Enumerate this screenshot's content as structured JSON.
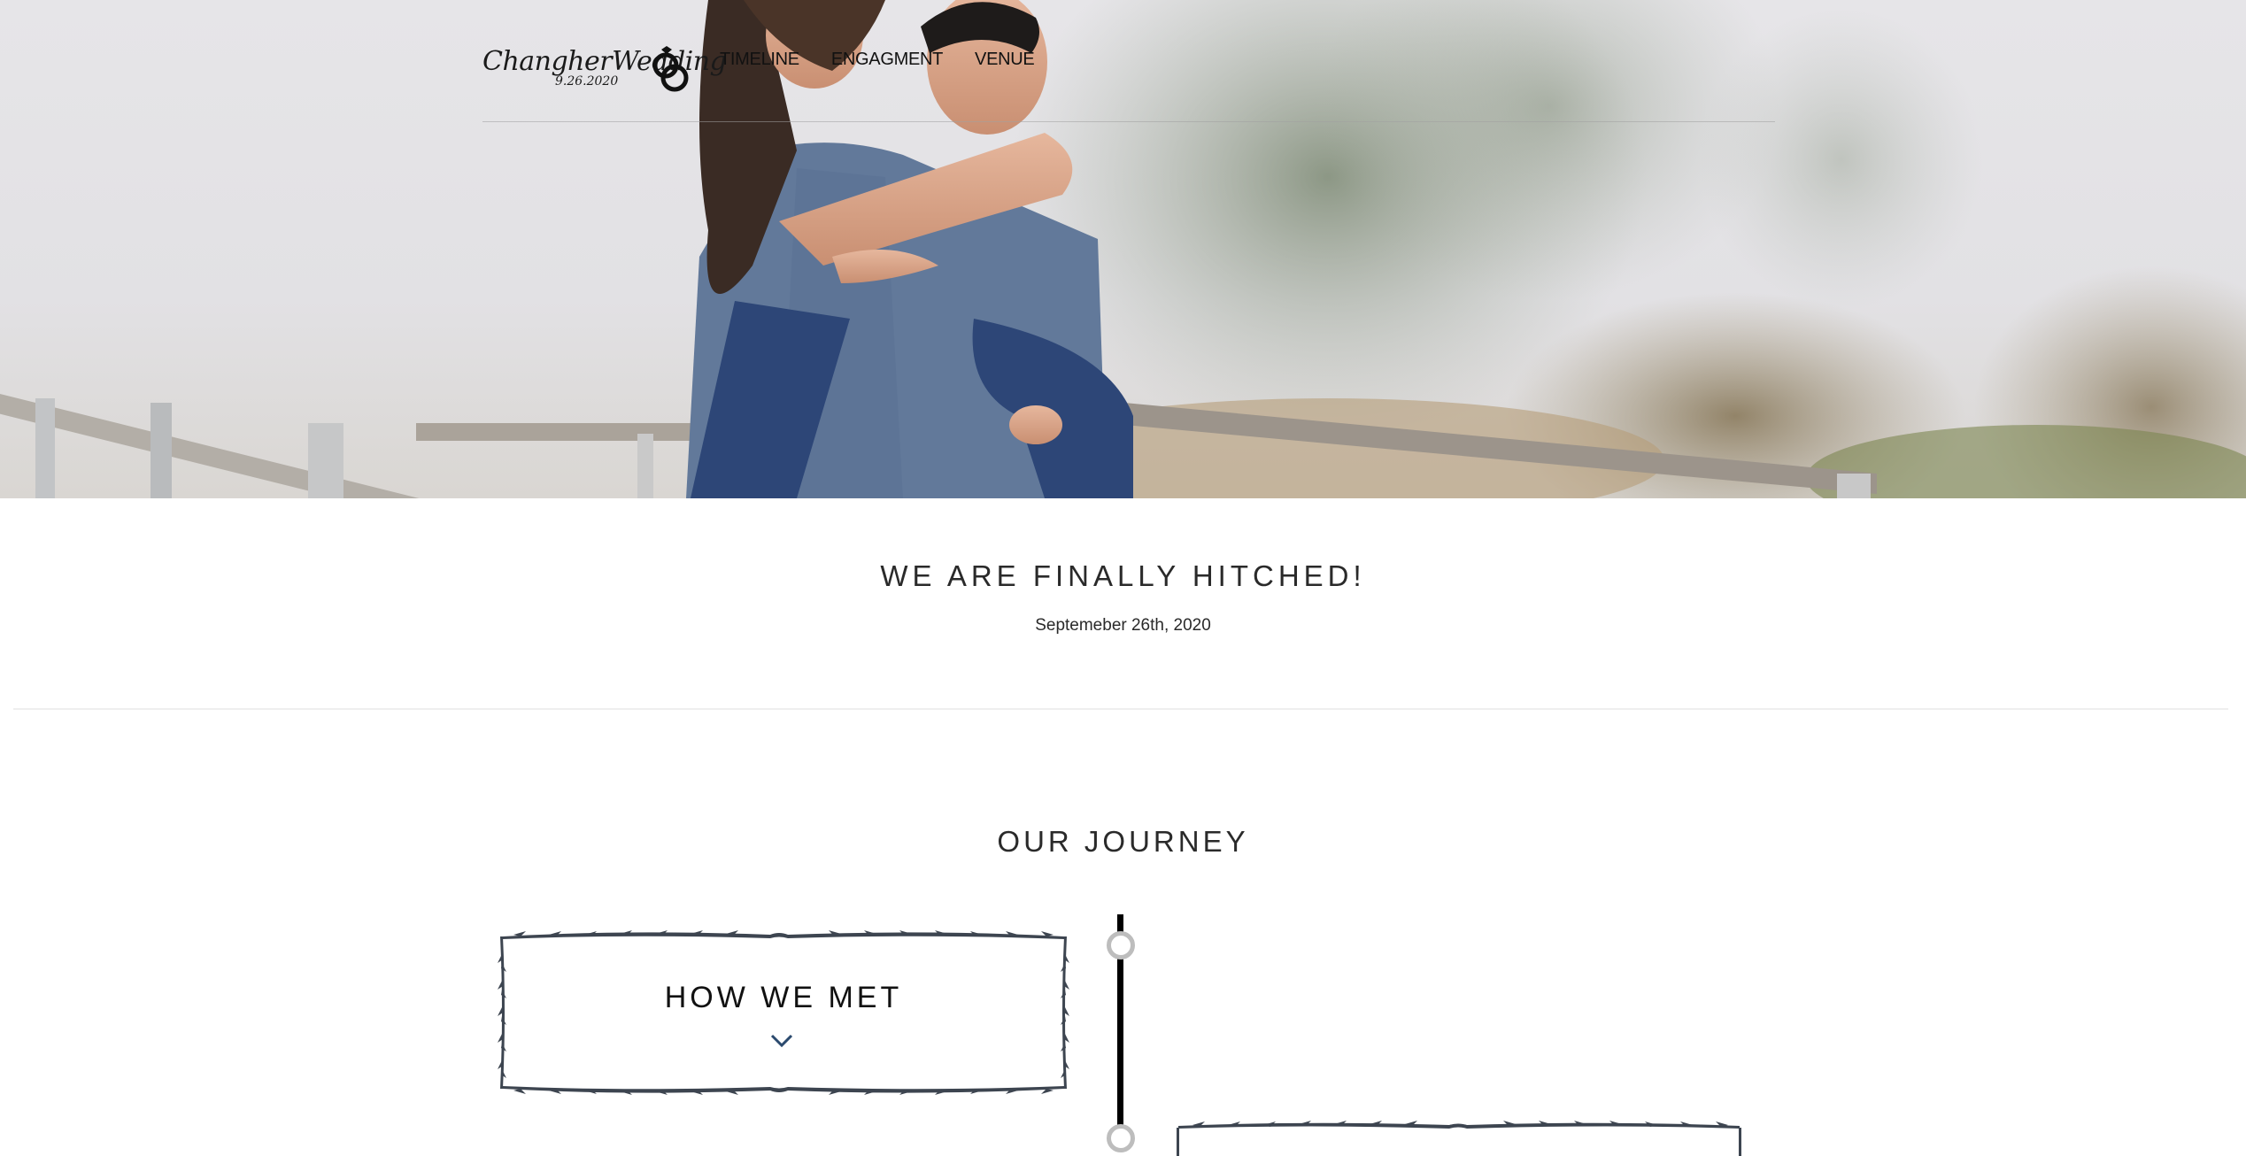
{
  "brand": {
    "name": "ChangherWedding",
    "date": "9.26.2020"
  },
  "nav": {
    "items": [
      {
        "label": "TIMELINE"
      },
      {
        "label": "ENGAGMENT"
      },
      {
        "label": "VENUE"
      }
    ]
  },
  "hero": {
    "headline": "WE ARE FINALLY HITCHED!",
    "date": "Septemeber 26th, 2020"
  },
  "journey": {
    "title": "OUR JOURNEY",
    "cards": [
      {
        "title": "HOW WE MET",
        "expand_icon": "chevron-down-icon"
      }
    ]
  },
  "colors": {
    "accent": "#2b4a6e",
    "text": "#2a2a2a",
    "timeline": "#000000",
    "node_ring": "#bdbdbd"
  }
}
